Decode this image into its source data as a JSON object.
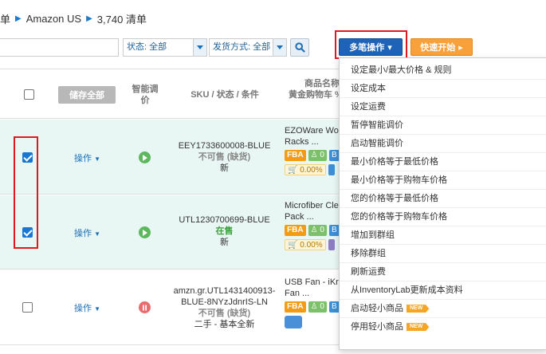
{
  "breadcrumb": {
    "part1": "单",
    "part2": "Amazon US",
    "part3": "3,740 清单"
  },
  "filters": {
    "search_value": "",
    "status_select": "状态: 全部",
    "shipping_select": "发货方式: 全部"
  },
  "toolbar": {
    "bulk_label": "多笔操作",
    "quick_label": "快速开始",
    "caret": "▾",
    "quick_caret": "▸"
  },
  "table": {
    "save_all": "储存全部",
    "col_smart": "智能调价",
    "col_sku": "SKU / 状态 / 条件",
    "col_product_1": "商品名称",
    "col_product_2": "黄金购物车 %",
    "action_label": "操作",
    "rows": [
      {
        "checked": true,
        "sku": "EEY1733600008-BLUE",
        "status": "不可售 (缺货)",
        "condition": "新",
        "title_1": "EZOWare Wo",
        "title_2": "Racks ...",
        "fba": "FBA",
        "count": "0",
        "pct": "0.00%"
      },
      {
        "checked": true,
        "sku": "UTL1230700699-BLUE",
        "status": "在售",
        "condition": "新",
        "title_1": "Microfiber Cle",
        "title_2": "Pack ...",
        "fba": "FBA",
        "count": "0",
        "pct": "0.00%"
      },
      {
        "checked": false,
        "sku_1": "amzn.gr.UTL1431400913-",
        "sku_2": "BLUE-8NYzJdnrIS-LN",
        "status": "不可售 (缺货)",
        "condition": "二手 - 基本全新",
        "title_1": "USB Fan - iKr",
        "title_2": "Fan ...",
        "fba": "FBA",
        "count": "0"
      }
    ]
  },
  "bulk_menu": {
    "items": [
      "设定最小/最大价格 & 规则",
      "设定成本",
      "设定运费",
      "暂停智能调价",
      "启动智能调价",
      "最小价格等于最低价格",
      "最小价格等于购物车价格",
      "您的价格等于最低价格",
      "您的价格等于购物车价格",
      "增加到群组",
      "移除群组",
      "刷新运费",
      "从InventoryLab更新成本资料",
      "启动轻小商品",
      "停用轻小商品"
    ],
    "new_badge": "NEW"
  },
  "colors": {
    "primary": "#1e63b8",
    "orange": "#f8a13a",
    "highlight_red": "#e0191f",
    "selected_row": "#e9f7f4",
    "on_sale_green": "#3aa13a"
  },
  "icons": [
    "chevron-right-icon",
    "search-icon",
    "play-icon",
    "pause-icon",
    "user-icon",
    "chat-icon",
    "cart-icon"
  ]
}
